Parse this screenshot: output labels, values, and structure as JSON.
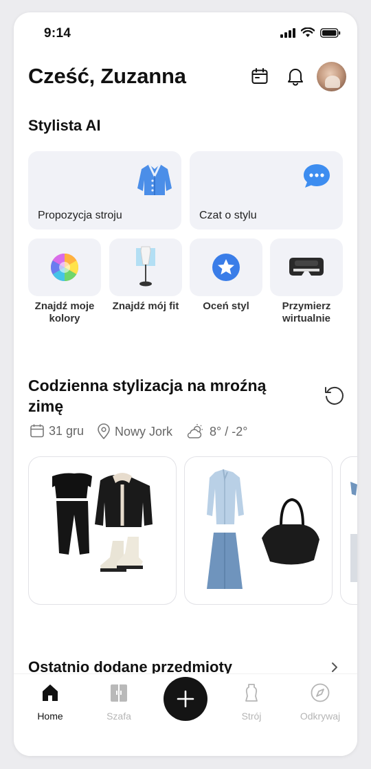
{
  "status": {
    "time": "9:14"
  },
  "header": {
    "greeting": "Cześć, Zuzanna"
  },
  "stylist": {
    "title": "Stylista AI",
    "cards": [
      {
        "label": "Propozycja stroju",
        "icon": "cardigan-icon"
      },
      {
        "label": "Czat o stylu",
        "icon": "chat-bubble-icon"
      }
    ],
    "tiles": [
      {
        "label": "Znajdź moje kolory",
        "icon": "color-wheel-icon"
      },
      {
        "label": "Znajdź mój fit",
        "icon": "mannequin-icon"
      },
      {
        "label": "Oceń styl",
        "icon": "star-badge-icon"
      },
      {
        "label": "Przymierz wirtualnie",
        "icon": "vr-headset-icon"
      }
    ]
  },
  "daily": {
    "title": "Codzienna stylizacja na mroźną zimę",
    "date": "31 gru",
    "location": "Nowy Jork",
    "weather": "8° / -2°"
  },
  "recent": {
    "title": "Ostatnio dodane przedmioty"
  },
  "tabs": [
    {
      "label": "Home",
      "icon": "home-icon"
    },
    {
      "label": "Szafa",
      "icon": "wardrobe-icon"
    },
    {
      "label": "Strój",
      "icon": "outfit-icon"
    },
    {
      "label": "Odkrywaj",
      "icon": "compass-icon"
    }
  ],
  "colors": {
    "accent": "#141414",
    "card_bg": "#f1f2f7",
    "muted": "#b5b5b5"
  }
}
